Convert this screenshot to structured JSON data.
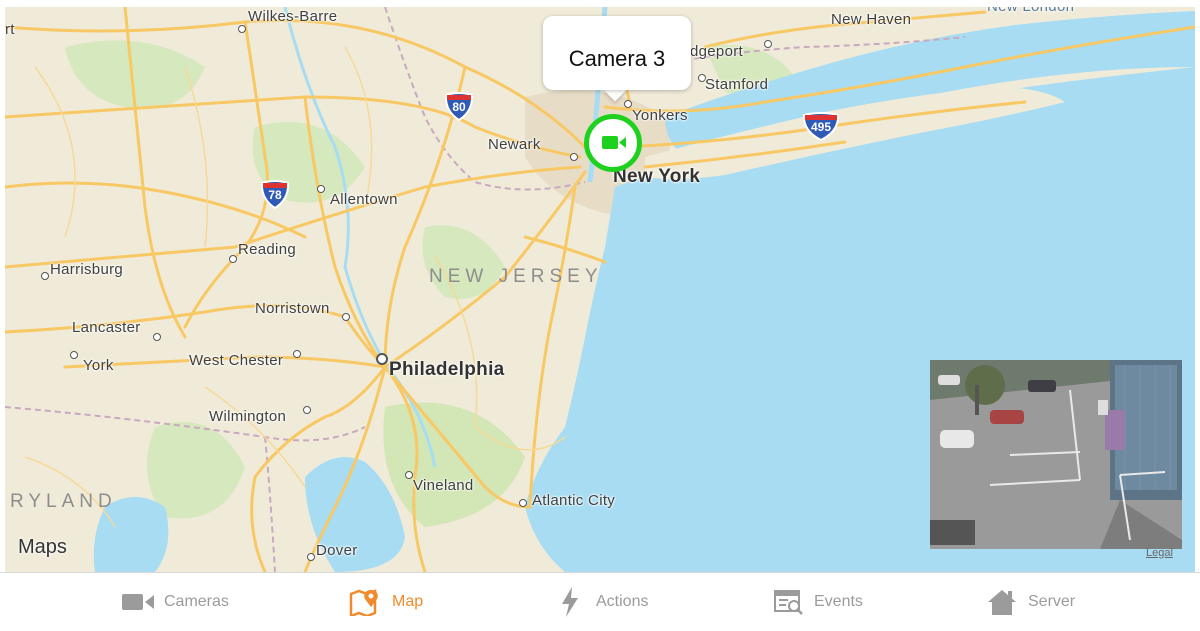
{
  "map": {
    "provider_logo": "Maps",
    "legal_link": "Legal",
    "cities": {
      "wilkes_barre": "Wilkes-Barre",
      "new_haven": "New Haven",
      "bridgeport": "dgeport",
      "stamford": "Stamford",
      "yonkers": "Yonkers",
      "newark": "Newark",
      "new_york": "New York",
      "allentown": "Allentown",
      "reading": "Reading",
      "harrisburg": "Harrisburg",
      "norristown": "Norristown",
      "lancaster": "Lancaster",
      "york": "York",
      "west_chester": "West Chester",
      "philadelphia": "Philadelphia",
      "wilmington": "Wilmington",
      "vineland": "Vineland",
      "atlantic_city": "Atlantic City",
      "dover": "Dover",
      "new_london": "New London",
      "left_edge": "rt"
    },
    "states": {
      "new_jersey": "NEW JERSEY",
      "maryland": "RYLAND"
    },
    "highway_shields": {
      "i80": "80",
      "i78": "78",
      "i495": "495"
    },
    "camera_pin": {
      "callout_label": "Camera 3",
      "icon": "video-camera-icon",
      "ring_color": "#1fd11f"
    },
    "colors": {
      "land": "#f0ebd8",
      "water": "#a7dcf3",
      "highway": "#f8c865",
      "urban": "#e9e0cc",
      "park": "#cde6b0"
    }
  },
  "tabbar": {
    "accent_color": "#f18a2a",
    "tabs": [
      {
        "label": "Cameras",
        "icon": "video-camera-icon"
      },
      {
        "label": "Map",
        "icon": "map-pin-icon",
        "active": true
      },
      {
        "label": "Actions",
        "icon": "lightning-bolt-icon"
      },
      {
        "label": "Events",
        "icon": "events-search-icon"
      },
      {
        "label": "Server",
        "icon": "home-icon"
      }
    ]
  }
}
